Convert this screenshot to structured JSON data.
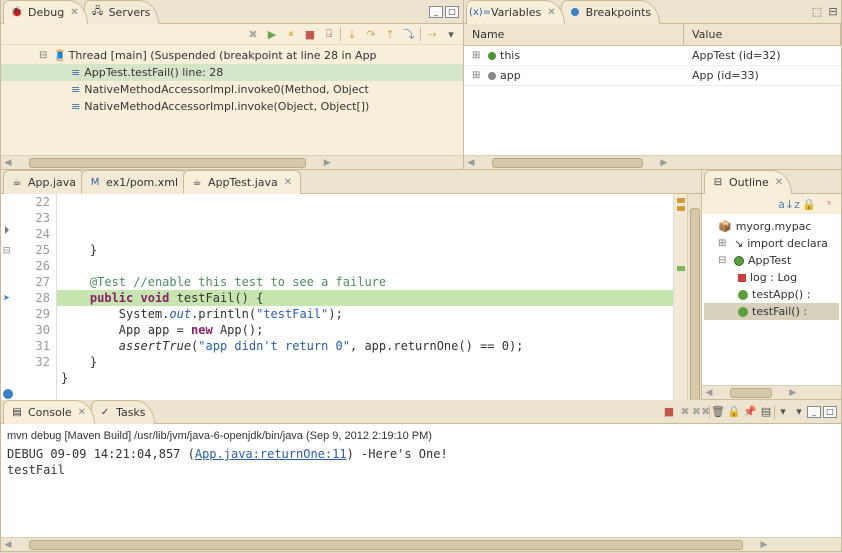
{
  "top_left": {
    "views": [
      {
        "label": "Debug",
        "icon": "bug-icon",
        "active": true
      },
      {
        "label": "Servers",
        "icon": "servers-icon",
        "active": false
      }
    ],
    "thread_label": "Thread [main] (Suspended (breakpoint at line 28 in App",
    "stack": [
      {
        "label": "AppTest.testFail() line: 28",
        "selected": true
      },
      {
        "label": "NativeMethodAccessorImpl.invoke0(Method, Object",
        "selected": false
      },
      {
        "label": "NativeMethodAccessorImpl.invoke(Object, Object[])",
        "selected": false
      }
    ]
  },
  "top_right": {
    "views": [
      {
        "label": "Variables",
        "icon": "variables-icon",
        "active": true
      },
      {
        "label": "Breakpoints",
        "icon": "breakpoints-icon",
        "active": false
      }
    ],
    "head": {
      "name": "Name",
      "value": "Value"
    },
    "rows": [
      {
        "name": "this",
        "value": "AppTest  (id=32)",
        "kind": "green"
      },
      {
        "name": "app",
        "value": "App  (id=33)",
        "kind": "grey"
      }
    ]
  },
  "editor": {
    "tabs": [
      {
        "label": "App.java",
        "icon": "java-file-icon",
        "active": false
      },
      {
        "label": "ex1/pom.xml",
        "icon": "xml-file-icon",
        "active": false
      },
      {
        "label": "AppTest.java",
        "icon": "java-file-icon",
        "active": true
      }
    ],
    "line_start": 22,
    "breakpoint_line": 28,
    "highlight_line": 28,
    "annotation_lines": {
      "test_marker": 24,
      "arrow": 28
    },
    "code_lines": [
      "    }",
      "",
      "    @Test //enable this test to see a failure",
      "    public void testFail() {",
      "        System.out.println(\"testFail\");",
      "        App app = new App();",
      "        assertTrue(\"app didn't return 0\", app.returnOne() == 0);",
      "    }",
      "}",
      "",
      ""
    ]
  },
  "outline": {
    "title": "Outline",
    "items": [
      {
        "label": "myorg.mypac",
        "kind": "pkg"
      },
      {
        "label": "import declara",
        "kind": "imp"
      },
      {
        "label": "AppTest",
        "kind": "cls"
      },
      {
        "label": "log : Log",
        "kind": "field",
        "indent": 1
      },
      {
        "label": "testApp() :",
        "kind": "method",
        "indent": 1
      },
      {
        "label": "testFail() :",
        "kind": "method",
        "indent": 1,
        "selected": true
      }
    ]
  },
  "console": {
    "views": [
      {
        "label": "Console",
        "icon": "console-icon",
        "active": true
      },
      {
        "label": "Tasks",
        "icon": "tasks-icon",
        "active": false
      }
    ],
    "title": "mvn debug [Maven Build] /usr/lib/jvm/java-6-openjdk/bin/java (Sep 9, 2012 2:19:10 PM)",
    "lines": [
      {
        "prefix": "DEBUG 09-09 14:21:04,857 (",
        "link": "App.java:returnOne:11",
        "suffix": ")  -Here's One!"
      },
      {
        "text": "testFail"
      }
    ]
  }
}
